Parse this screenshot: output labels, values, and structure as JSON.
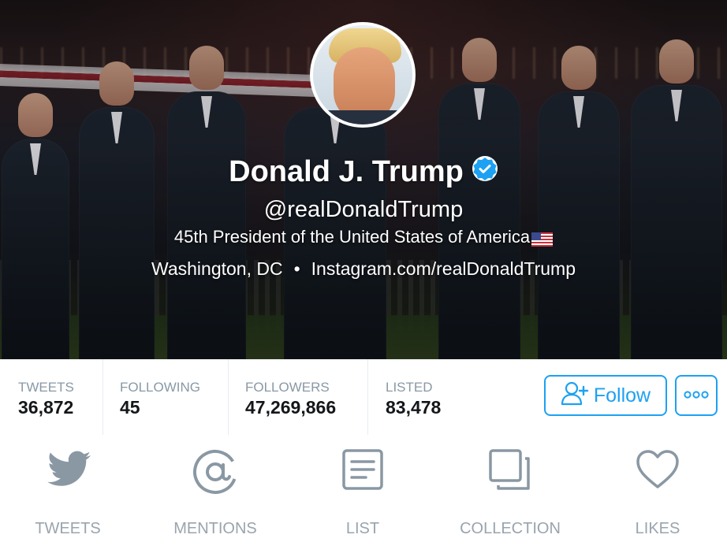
{
  "profile": {
    "name": "Donald J. Trump",
    "handle": "@realDonaldTrump",
    "bio": "45th President of the United States of America",
    "location": "Washington, DC",
    "separator": "•",
    "website": "Instagram.com/realDonaldTrump"
  },
  "stats": [
    {
      "label": "TWEETS",
      "value": "36,872"
    },
    {
      "label": "FOLLOWING",
      "value": "45"
    },
    {
      "label": "FOLLOWERS",
      "value": "47,269,866"
    },
    {
      "label": "LISTED",
      "value": "83,478"
    }
  ],
  "actions": {
    "follow_label": "Follow",
    "more_icon": "ellipsis-icon"
  },
  "tabs": [
    {
      "label": "TWEETS",
      "icon": "bird-icon"
    },
    {
      "label": "MENTIONS",
      "icon": "at-sign-icon"
    },
    {
      "label": "LIST",
      "icon": "list-icon"
    },
    {
      "label": "COLLECTION",
      "icon": "collection-icon"
    },
    {
      "label": "LIKES",
      "icon": "heart-icon"
    }
  ],
  "colors": {
    "accent": "#1da1f2",
    "stat_label": "#8899a6",
    "stat_value": "#14171a",
    "tab_icon": "#8a98a4",
    "verified": "#1da1f2"
  }
}
